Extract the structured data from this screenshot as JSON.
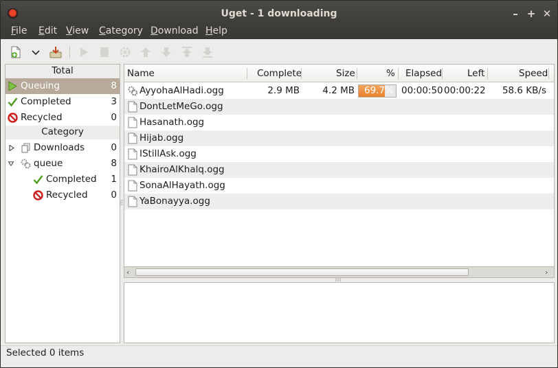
{
  "window": {
    "title": "Uget - 1 downloading"
  },
  "menu": {
    "items": [
      "File",
      "Edit",
      "View",
      "Category",
      "Download",
      "Help"
    ]
  },
  "sidebar": {
    "total_header": "Total",
    "total_items": [
      {
        "label": "Queuing",
        "count": "8",
        "icon": "play-icon"
      },
      {
        "label": "Completed",
        "count": "3",
        "icon": "checkmark-icon"
      },
      {
        "label": "Recycled",
        "count": "0",
        "icon": "prohibited-icon"
      }
    ],
    "category_header": "Category",
    "categories": [
      {
        "label": "Downloads",
        "count": "0",
        "icon": "category-icon",
        "expanded": false
      },
      {
        "label": "queue",
        "count": "8",
        "icon": "category-icon",
        "expanded": true,
        "children": [
          {
            "label": "Completed",
            "count": "1",
            "icon": "checkmark-icon"
          },
          {
            "label": "Recycled",
            "count": "0",
            "icon": "prohibited-icon"
          }
        ]
      }
    ]
  },
  "list": {
    "columns": [
      "Name",
      "Complete",
      "Size",
      "%",
      "Elapsed",
      "Left",
      "Speed"
    ],
    "rows": [
      {
        "name": "AyyohaAlHadi.ogg",
        "complete": "2.9 MB",
        "size": "4.2 MB",
        "percent": "69.7%",
        "progress": 69.7,
        "elapsed": "00:00:50",
        "left": "00:00:22",
        "speed": "58.6 KB/s",
        "status": "downloading"
      },
      {
        "name": "DontLetMeGo.ogg"
      },
      {
        "name": "Hasanath.ogg"
      },
      {
        "name": "Hijab.ogg"
      },
      {
        "name": "IStillAsk.ogg"
      },
      {
        "name": "KhairoAlKhalq.ogg"
      },
      {
        "name": "SonaAlHayath.ogg"
      },
      {
        "name": "YaBonayya.ogg"
      }
    ]
  },
  "status": {
    "text": "Selected 0 items"
  },
  "colors": {
    "selected_row": "#b8aa9b",
    "progress_fill": "#e8802a",
    "titlebar": "#3d3c38"
  }
}
